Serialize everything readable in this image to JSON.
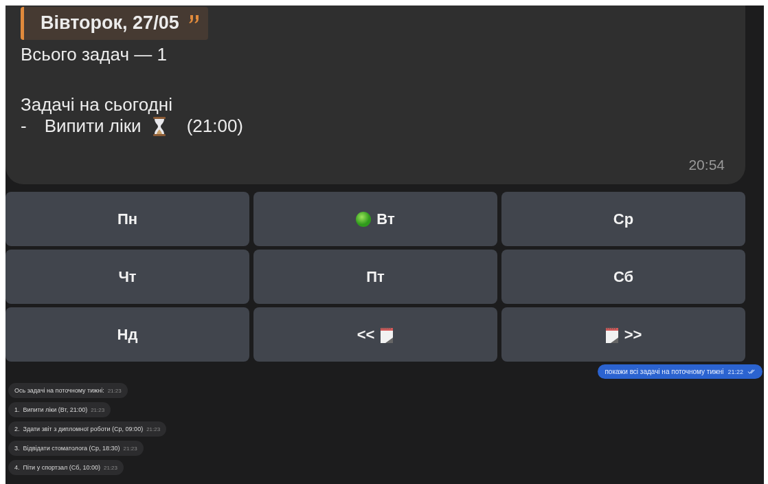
{
  "bot_message": {
    "quote_title": "Вівторок, 27/05",
    "summary": "Всього задач — 1",
    "section_title": "Задачі на сьогодні",
    "task": {
      "prefix": "-",
      "name": "Випити ліки",
      "time": "(21:00)"
    },
    "time": "20:54"
  },
  "keyboard": [
    {
      "kind": "day",
      "label": "Пн",
      "today": false
    },
    {
      "kind": "day",
      "label": "Вт",
      "today": true
    },
    {
      "kind": "day",
      "label": "Ср",
      "today": false
    },
    {
      "kind": "day",
      "label": "Чт",
      "today": false
    },
    {
      "kind": "day",
      "label": "Пт",
      "today": false
    },
    {
      "kind": "day",
      "label": "Сб",
      "today": false
    },
    {
      "kind": "day",
      "label": "Нд",
      "today": false
    },
    {
      "kind": "prev",
      "label": "<<"
    },
    {
      "kind": "next",
      "label": ">>"
    }
  ],
  "outgoing_message": {
    "text": "покажи всі задачі на поточному тижні",
    "time": "21:22",
    "read": true
  },
  "incoming_messages": [
    {
      "text": "Ось задачі на поточному тижні:",
      "time": "21:23"
    },
    {
      "text": "1.  Випити ліки (Вт, 21:00)",
      "time": "21:23"
    },
    {
      "text": "2.  Здати звіт з дипломної роботи (Ср, 09:00)",
      "time": "21:23"
    },
    {
      "text": "3.  Відвідати стоматолога (Ср, 18:30)",
      "time": "21:23"
    },
    {
      "text": "4.  Піти у спортзал (Сб, 10:00)",
      "time": "21:23"
    }
  ]
}
